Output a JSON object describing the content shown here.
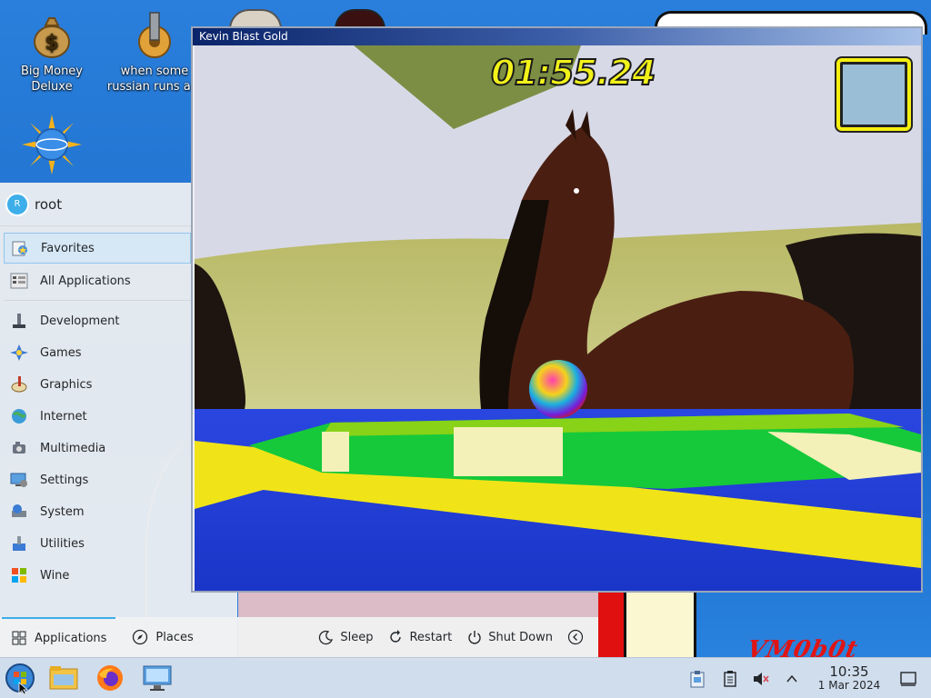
{
  "desktop": {
    "icons": [
      {
        "label": "Big Money Deluxe",
        "icon": "money-bag-icon"
      },
      {
        "label": "when some russian runs a...",
        "icon": "gear-icon"
      },
      {
        "label": "",
        "icon": "globe-sun-icon"
      }
    ],
    "signature_text": "VM0b0t"
  },
  "launcher": {
    "user_initial": "R",
    "user_name": "root",
    "top_items": [
      {
        "label": "Favorites",
        "icon": "favorites-icon",
        "selected": true
      },
      {
        "label": "All Applications",
        "icon": "all-applications-icon",
        "selected": false
      }
    ],
    "categories": [
      {
        "label": "Development",
        "icon": "development-icon"
      },
      {
        "label": "Games",
        "icon": "games-icon"
      },
      {
        "label": "Graphics",
        "icon": "graphics-icon"
      },
      {
        "label": "Internet",
        "icon": "internet-icon"
      },
      {
        "label": "Multimedia",
        "icon": "multimedia-icon"
      },
      {
        "label": "Settings",
        "icon": "settings-icon"
      },
      {
        "label": "System",
        "icon": "system-icon"
      },
      {
        "label": "Utilities",
        "icon": "utilities-icon"
      },
      {
        "label": "Wine",
        "icon": "wine-icon"
      }
    ],
    "footer": {
      "applications_tab": "Applications",
      "places_tab": "Places",
      "sleep": "Sleep",
      "restart": "Restart",
      "shut_down": "Shut Down"
    }
  },
  "game": {
    "window_title": "Kevin Blast Gold",
    "timer": "01:55.24",
    "colors": {
      "hud_text": "#f2f21a",
      "minimap_bg": "#9abed6",
      "floor_blue": "#1e3fd0",
      "platform_green": "#16c93a"
    }
  },
  "taskbar": {
    "pinned": [
      "start-menu-icon",
      "file-manager-icon",
      "firefox-icon",
      "system-settings-icon"
    ],
    "clock_time": "10:35",
    "clock_date": "1 Mar 2024"
  }
}
